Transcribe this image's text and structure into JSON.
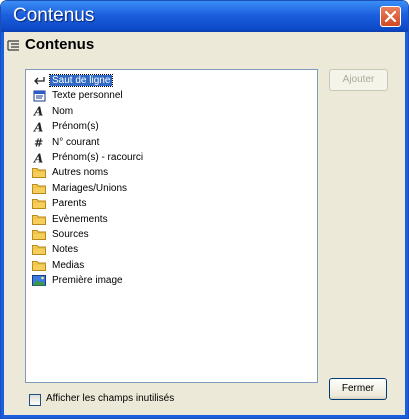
{
  "window": {
    "title": "Contenus"
  },
  "header": {
    "label": "Contenus"
  },
  "list": {
    "items": [
      {
        "label": "Saut de ligne",
        "icon": "line-break-icon",
        "selected": true
      },
      {
        "label": "Texte personnel",
        "icon": "custom-text-icon"
      },
      {
        "label": "Nom",
        "icon": "field-a-icon"
      },
      {
        "label": "Prénom(s)",
        "icon": "field-a-icon"
      },
      {
        "label": "N° courant",
        "icon": "hash-icon"
      },
      {
        "label": "Prénom(s) - racourci",
        "icon": "field-a-icon"
      },
      {
        "label": "Autres noms",
        "icon": "folder-icon"
      },
      {
        "label": "Mariages/Unions",
        "icon": "folder-icon"
      },
      {
        "label": "Parents",
        "icon": "folder-icon"
      },
      {
        "label": "Evènements",
        "icon": "folder-icon"
      },
      {
        "label": "Sources",
        "icon": "folder-icon"
      },
      {
        "label": "Notes",
        "icon": "folder-icon"
      },
      {
        "label": "Medias",
        "icon": "folder-icon"
      },
      {
        "label": "Première image",
        "icon": "image-icon"
      }
    ]
  },
  "buttons": {
    "add_label": "Ajouter",
    "close_label": "Fermer"
  },
  "options": {
    "show_unused_label": "Afficher les champs inutilisés",
    "show_unused_checked": false
  },
  "colors": {
    "titlebar": "#1c5fde",
    "selection": "#316ac5",
    "folder": "#f5cf5a",
    "close_button": "#d04a22"
  }
}
